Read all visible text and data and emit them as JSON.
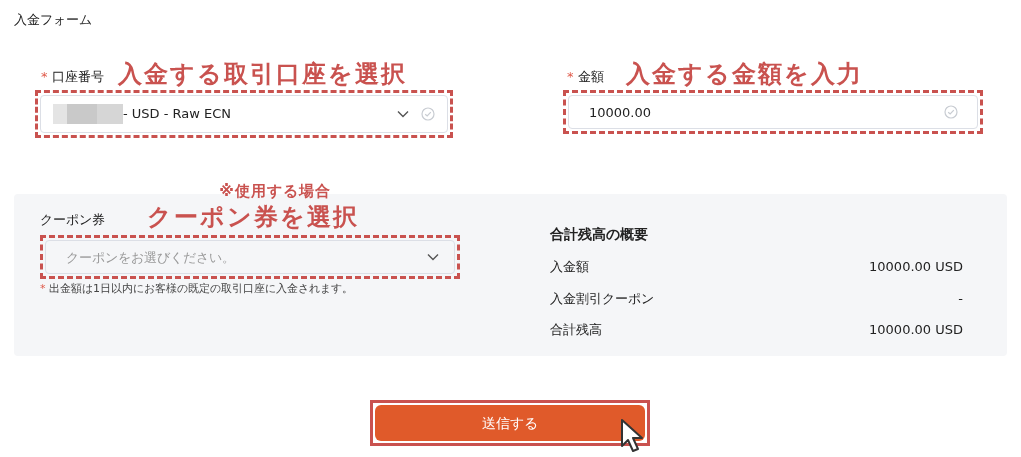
{
  "title": "入金フォーム",
  "account": {
    "label": "口座番号",
    "required": true,
    "annotation": "入金する取引口座を選択",
    "value": "- USD - Raw ECN"
  },
  "amount": {
    "label": "金額",
    "required": true,
    "annotation": "入金する金額を入力",
    "value": "10000.00"
  },
  "coupon": {
    "label": "クーポン券",
    "note_annotation": "※使用する場合",
    "annotation": "クーポン券を選択",
    "placeholder": "クーポンをお選びください。",
    "footnote_mark": "*",
    "footnote": "出金額は1日以内にお客様の既定の取引口座に入金されます。"
  },
  "summary": {
    "title": "合計残高の概要",
    "rows": [
      {
        "label": "入金額",
        "value": "10000.00 USD"
      },
      {
        "label": "入金割引クーポン",
        "value": "-"
      },
      {
        "label": "合計残高",
        "value": "10000.00 USD"
      }
    ]
  },
  "submit": {
    "label": "送信する"
  }
}
